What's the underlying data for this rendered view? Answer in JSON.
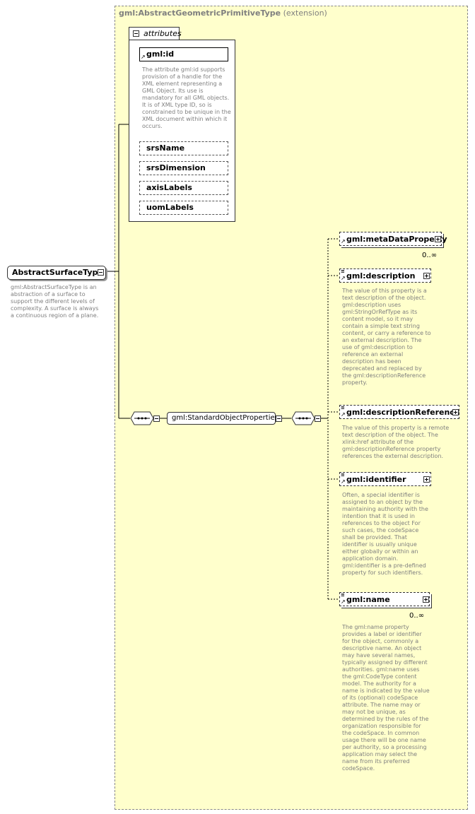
{
  "extension_panel": {
    "type_name": "gml:AbstractGeometricPrimitiveType",
    "qualifier": "(extension)"
  },
  "attributes": {
    "tab_label": "attributes",
    "items": [
      {
        "name": "gml:id",
        "doc": "The attribute gml:id supports provision of a handle for the XML element representing a GML Object. Its use is mandatory for all GML objects. It is of XML type ID, so is constrained to be unique in the XML document within which it occurs."
      },
      {
        "name": "srsName"
      },
      {
        "name": "srsDimension"
      },
      {
        "name": "axisLabels"
      },
      {
        "name": "uomLabels"
      }
    ]
  },
  "root": {
    "name": "AbstractSurfaceType",
    "doc": "gml:AbstractSurfaceType is an abstraction of a surface to support the different levels of complexity. A surface is always a continuous region of a plane."
  },
  "group": {
    "name": "gml:StandardObjectProperties"
  },
  "elements": [
    {
      "name": "gml:metaDataProperty",
      "cardinality": "0..∞"
    },
    {
      "name": "gml:description",
      "doc": "The value of this property is a text description of the object. gml:description uses gml:StringOrRefType as its content model, so it may contain a simple text string content, or carry a reference to an external description. The use of gml:description to reference an external description has been deprecated and replaced by the gml:descriptionReference property."
    },
    {
      "name": "gml:descriptionReference",
      "doc": "The value of this property is a remote text description of the object. The xlink:href attribute of the gml:descriptionReference property references the external description."
    },
    {
      "name": "gml:identifier",
      "doc": "Often, a special identifier is assigned to an object by the maintaining authority with the intention that it is used in references to the object For such cases, the codeSpace shall be provided. That identifier is usually unique either globally or within an application domain. gml:identifier is a pre-defined property for such identifiers."
    },
    {
      "name": "gml:name",
      "cardinality": "0..∞",
      "doc": "The gml:name property provides a label or identifier for the object, commonly a descriptive name. An object may have several names, typically assigned by different authorities. gml:name uses the gml:CodeType content model.  The authority for a name is indicated by the value of its (optional) codeSpace attribute.  The name may or may not be unique, as determined by the rules of the organization responsible for the codeSpace.  In common usage there will be one name per authority, so a processing application may select the name from its preferred codeSpace."
    }
  ]
}
